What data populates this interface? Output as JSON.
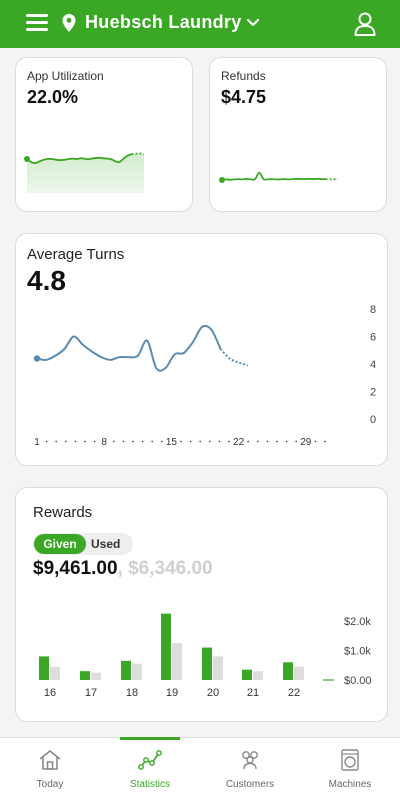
{
  "header": {
    "location": "Huebsch Laundry"
  },
  "cards": {
    "app_utilization": {
      "label": "App Utilization",
      "value": "22.0%"
    },
    "refunds": {
      "label": "Refunds",
      "value": "$4.75"
    }
  },
  "average_turns": {
    "title": "Average Turns",
    "value": "4.8"
  },
  "rewards": {
    "title": "Rewards",
    "toggle": {
      "given": "Given",
      "used": "Used"
    },
    "given_amount": "$9,461.00",
    "separator": ",",
    "used_amount": "$6,346.00"
  },
  "chart_data": [
    {
      "type": "line",
      "name": "app-utilization-sparkline",
      "x": [
        1,
        2,
        3,
        4,
        5,
        6,
        7,
        8,
        9,
        10,
        11,
        12,
        13,
        14,
        15,
        16,
        17,
        18,
        19,
        20,
        21,
        22,
        23,
        24,
        25,
        26,
        27,
        28,
        29
      ],
      "values": [
        0.6,
        0.52,
        0.5,
        0.54,
        0.58,
        0.6,
        0.6,
        0.58,
        0.57,
        0.58,
        0.6,
        0.61,
        0.6,
        0.62,
        0.6,
        0.6,
        0.62,
        0.63,
        0.62,
        0.61,
        0.6,
        0.55,
        0.52,
        0.6,
        0.68,
        0.72,
        0.73,
        0.74,
        0.72
      ],
      "color": "#3aa824"
    },
    {
      "type": "line",
      "name": "refunds-sparkline",
      "x": [
        1,
        2,
        3,
        4,
        5,
        6,
        7,
        8,
        9,
        10,
        11,
        12,
        13,
        14,
        15,
        16,
        17,
        18,
        19,
        20,
        21,
        22,
        23,
        24,
        25,
        26,
        27,
        28,
        29
      ],
      "values": [
        0.1,
        0.12,
        0.11,
        0.12,
        0.13,
        0.12,
        0.14,
        0.12,
        0.13,
        0.35,
        0.13,
        0.12,
        0.13,
        0.12,
        0.12,
        0.13,
        0.12,
        0.13,
        0.14,
        0.13,
        0.13,
        0.14,
        0.13,
        0.14,
        0.13,
        0.13,
        0.12,
        0.13,
        0.12
      ],
      "color": "#3aa824"
    },
    {
      "type": "line",
      "title": "Average Turns",
      "x": [
        1,
        2,
        3,
        4,
        5,
        6,
        7,
        8,
        9,
        10,
        11,
        12,
        13,
        14,
        15,
        16,
        17,
        18,
        19,
        20,
        21,
        22,
        23,
        24
      ],
      "values": [
        4.4,
        4.3,
        4.6,
        5.1,
        6.0,
        5.4,
        4.9,
        4.5,
        4.3,
        4.5,
        4.5,
        4.6,
        5.7,
        3.7,
        3.7,
        4.7,
        4.8,
        5.6,
        6.7,
        6.5,
        5.1,
        4.4,
        4.1,
        3.9
      ],
      "x_ticks": [
        "1",
        "8",
        "15",
        "22",
        "29"
      ],
      "y_ticks": [
        "0",
        "2",
        "4",
        "6",
        "8"
      ],
      "ylim": [
        0,
        8
      ],
      "color": "#5a8bb0"
    },
    {
      "type": "bar",
      "title": "Rewards",
      "categories": [
        "16",
        "17",
        "18",
        "19",
        "20",
        "21",
        "22"
      ],
      "series": [
        {
          "name": "Given",
          "values": [
            800,
            300,
            650,
            2250,
            1100,
            350,
            600
          ],
          "color": "#3aa824"
        },
        {
          "name": "Used",
          "values": [
            450,
            250,
            550,
            1250,
            800,
            300,
            450
          ],
          "color": "#dddddd"
        }
      ],
      "y_ticks": [
        "$0.00",
        "$1.0k",
        "$2.0k"
      ],
      "ylim": [
        0,
        2000
      ]
    }
  ],
  "tabs": [
    {
      "label": "Today",
      "icon": "home-icon"
    },
    {
      "label": "Statistics",
      "icon": "statistics-icon",
      "active": true
    },
    {
      "label": "Customers",
      "icon": "customers-icon"
    },
    {
      "label": "Machines",
      "icon": "washer-icon"
    }
  ],
  "colors": {
    "brand": "#3aa824",
    "line_blue": "#5a8bb0"
  }
}
